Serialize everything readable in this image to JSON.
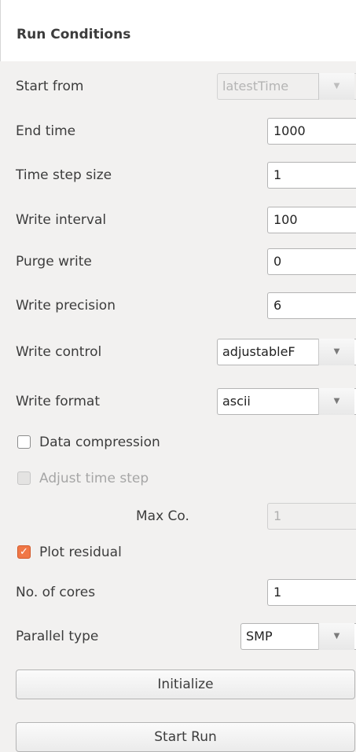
{
  "panel": {
    "title": "Run Conditions"
  },
  "start_from": {
    "label": "Start from",
    "value": "latestTime"
  },
  "end_time": {
    "label": "End time",
    "value": "1000"
  },
  "time_step": {
    "label": "Time step size",
    "value": "1"
  },
  "write_interval": {
    "label": "Write interval",
    "value": "100"
  },
  "purge_write": {
    "label": "Purge write",
    "value": "0"
  },
  "write_precision": {
    "label": "Write precision",
    "value": "6"
  },
  "write_control": {
    "label": "Write control",
    "value": "adjustableF"
  },
  "write_format": {
    "label": "Write format",
    "value": "ascii"
  },
  "data_compression": {
    "label": "Data compression",
    "checked": false
  },
  "adjust_time_step": {
    "label": "Adjust time step",
    "checked": false,
    "enabled": false
  },
  "max_co": {
    "label": "Max Co.",
    "value": "1"
  },
  "plot_residual": {
    "label": "Plot residual",
    "checked": true
  },
  "cores": {
    "label": "No. of cores",
    "value": "1"
  },
  "parallel_type": {
    "label": "Parallel type",
    "value": "SMP"
  },
  "buttons": {
    "initialize": "Initialize",
    "start_run": "Start Run"
  },
  "icons": {
    "dropdown": "▼",
    "checkmark": "✓"
  },
  "colors": {
    "accent_check": "#f07746"
  }
}
